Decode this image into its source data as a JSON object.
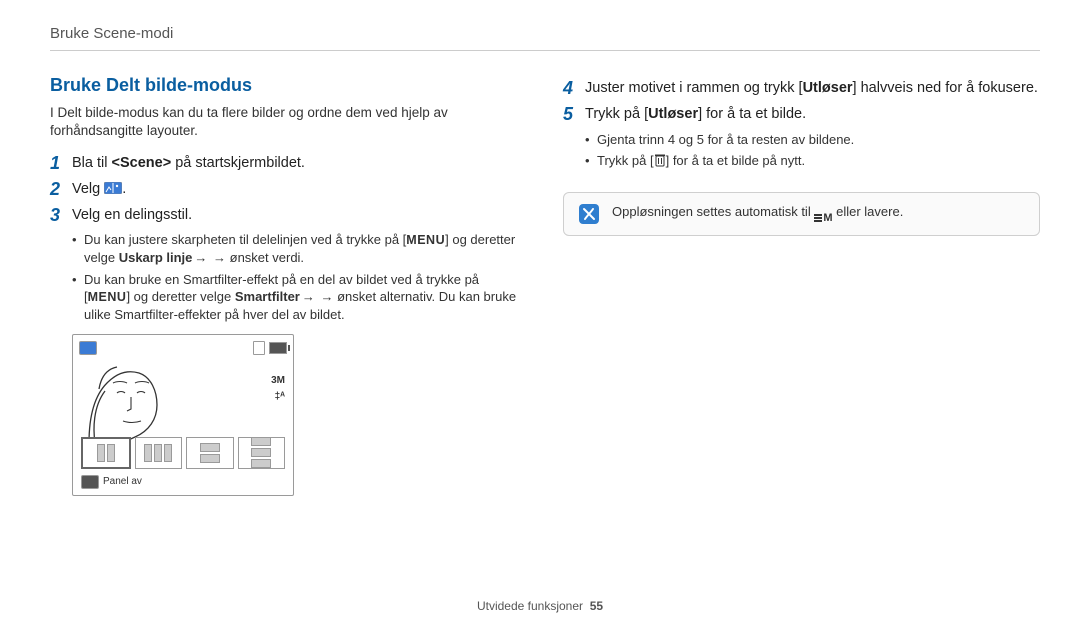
{
  "running_head": "Bruke Scene-modi",
  "section_title": "Bruke Delt bilde-modus",
  "intro": "I Delt bilde-modus kan du ta flere bilder og ordne dem ved hjelp av forhåndsangitte layouter.",
  "left": {
    "steps": {
      "1": {
        "num": "1",
        "pre": "Bla til ",
        "scene": "<Scene>",
        "post": " på startskjermbildet."
      },
      "2": {
        "num": "2",
        "main": "Velg ",
        "tail": "."
      },
      "3": {
        "num": "3",
        "main": "Velg en delingsstil.",
        "sub": {
          "a_pre": "Du kan justere skarpheten til delelinjen ved å trykke på [",
          "a_menu": "MENU",
          "a_mid": "] og deretter velge ",
          "a_bold": "Uskarp linje",
          "a_post": " → ønsket verdi.",
          "b_pre": "Du kan bruke en Smartfilter-effekt på en del av bildet ved å trykke på [",
          "b_menu": "MENU",
          "b_mid": "] og deretter velge ",
          "b_bold": "Smartfilter",
          "b_post": " → ønsket alternativ. Du kan bruke ulike Smartfilter-effekter på hver del av bildet."
        }
      }
    },
    "illus": {
      "res": "3M",
      "flash": "‡ᴬ",
      "panel_off": "Panel av"
    }
  },
  "right": {
    "steps": {
      "4": {
        "num": "4",
        "pre": "Juster motivet i rammen og trykk [",
        "bold": "Utløser",
        "post": "] halvveis ned for å fokusere."
      },
      "5": {
        "num": "5",
        "pre": "Trykk på [",
        "bold": "Utløser",
        "post": "] for å ta et bilde.",
        "sub": {
          "a": "Gjenta trinn 4 og 5 for å ta resten av bildene.",
          "b_pre": "Trykk på [",
          "b_post": "] for å ta et bilde på nytt."
        }
      }
    },
    "note_pre": "Oppløsningen settes automatisk til ",
    "note_res": "M",
    "note_post": " eller lavere."
  },
  "footer": {
    "section": "Utvidede funksjoner",
    "page": "55"
  }
}
